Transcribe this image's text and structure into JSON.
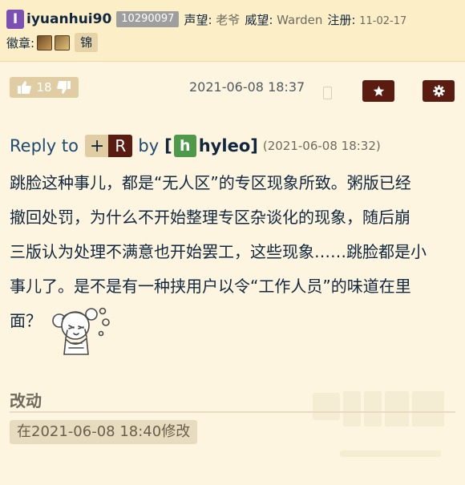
{
  "user": {
    "avatar_letter": "I",
    "name": "iyuanhui90",
    "uid": "10290097",
    "reputation_label": "声望:",
    "reputation_value": "老爷",
    "prestige_label": "威望:",
    "prestige_value": "Warden",
    "register_label": "注册:",
    "register_value": "11-02-17",
    "badges_label": "徽章:",
    "badge_tag": "锦"
  },
  "toolbar": {
    "vote_count": "18",
    "timestamp": "2021-06-08 18:37"
  },
  "reply": {
    "reply_to": "Reply to",
    "plus_symbol": "+",
    "target_letter": "R",
    "by_word": "by",
    "bracket_open": "[",
    "author_letter": "h",
    "author_name": "hyleo",
    "bracket_close": "]",
    "reply_date": "(2021-06-08 18:32)"
  },
  "post": {
    "line1": "跳脸这种事儿，都是“无人区”的专区现象所致。粥版已经",
    "line2": "撤回处罚，为什么不开始整理专区杂谈化的现象，随后崩",
    "line3": "三版认为处理不满意也开始罢工，这些现象……跳脸都是小",
    "line4": "事儿了。是不是有一种挟用户以令“工作人员”的味道在里",
    "line5": "面？"
  },
  "edit": {
    "label": "改动",
    "note": "在2021-06-08 18:40修改"
  },
  "colors": {
    "background": "#fdf5e0",
    "accent_dark": "#5a1b10",
    "link_blue": "#1c4a73",
    "pill": "#e1cda3"
  }
}
